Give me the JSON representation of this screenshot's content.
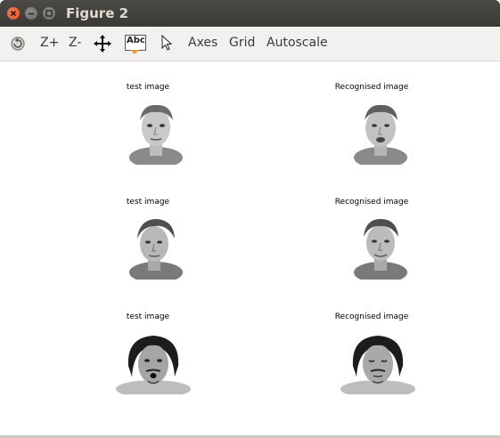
{
  "window": {
    "title": "Figure 2"
  },
  "toolbar": {
    "zoom_in": "Z+",
    "zoom_out": "Z-",
    "text_tool": "Abc",
    "axes": "Axes",
    "grid": "Grid",
    "autoscale": "Autoscale"
  },
  "figure": {
    "panels": [
      {
        "left_title": "test image",
        "right_title": "Recognised image"
      },
      {
        "left_title": "test image",
        "right_title": "Recognised image"
      },
      {
        "left_title": "test image",
        "right_title": "Recognised image"
      }
    ]
  }
}
